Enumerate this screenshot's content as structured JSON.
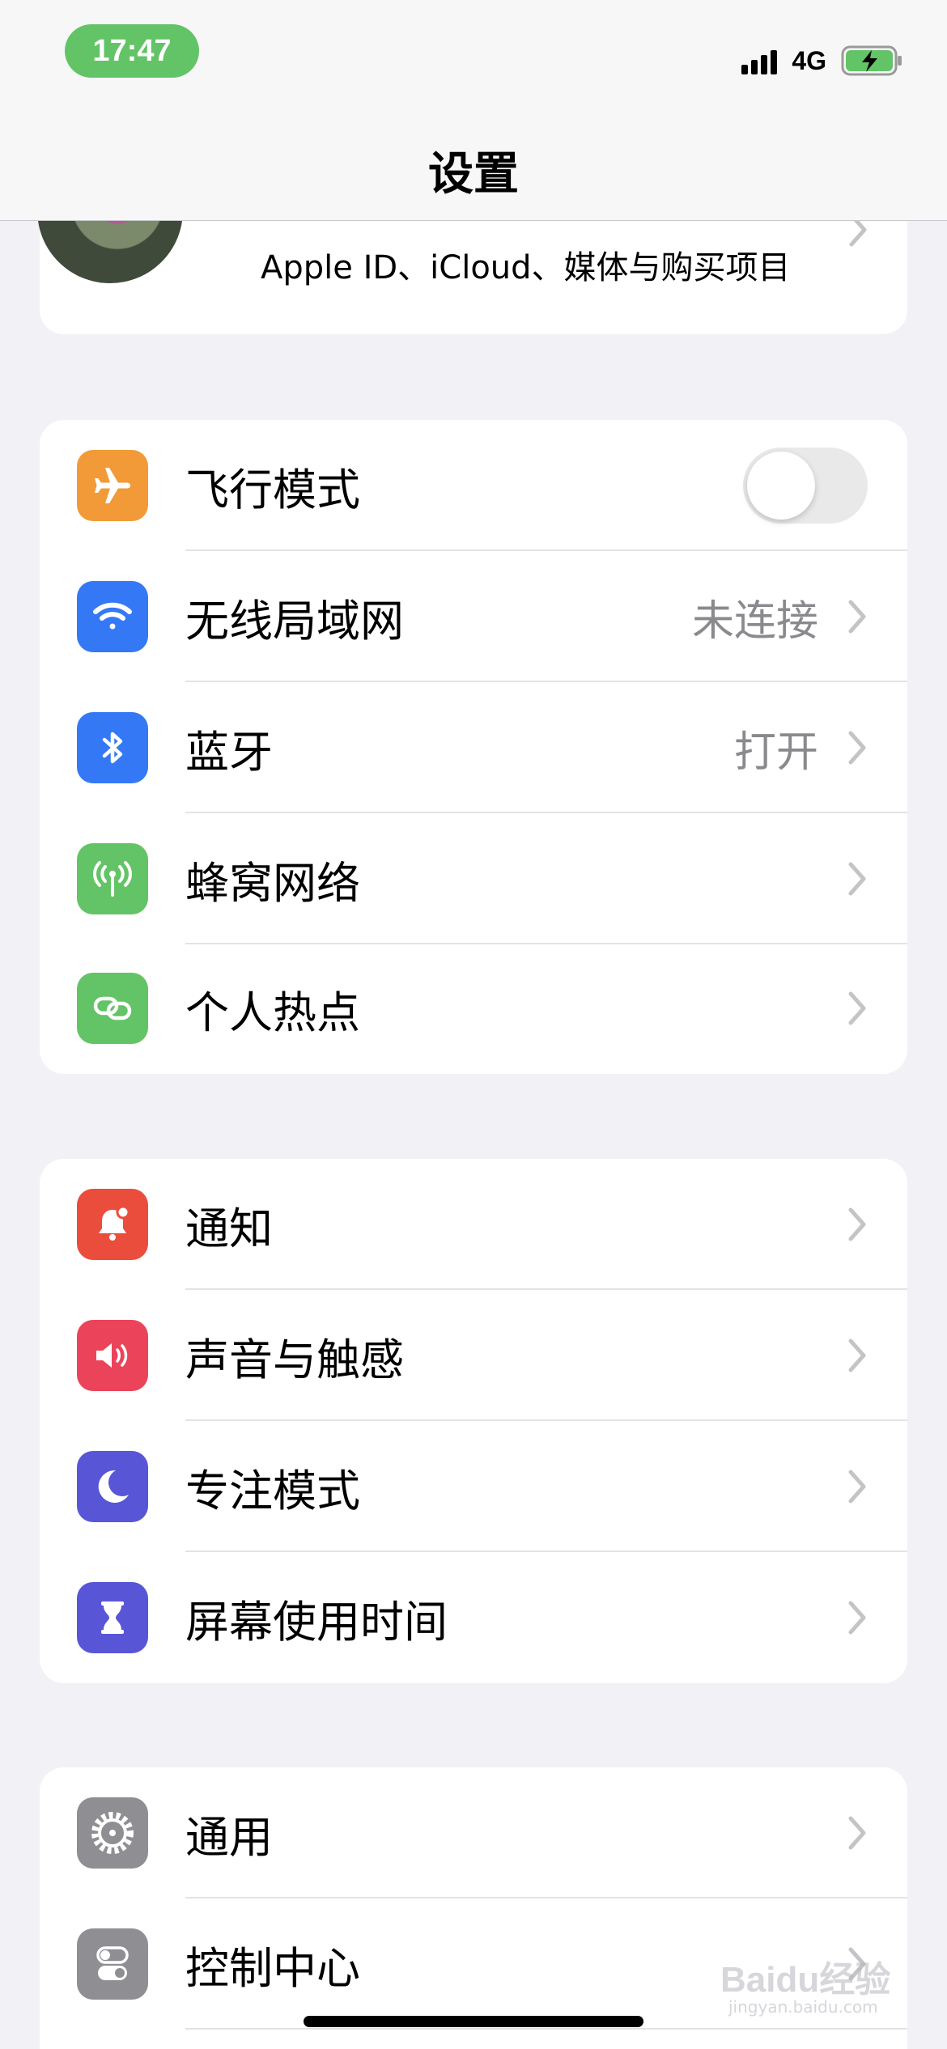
{
  "status_bar": {
    "time": "17:47",
    "network_type": "4G",
    "battery_state": "charging",
    "accent_color": "#62c466"
  },
  "nav": {
    "title": "设置"
  },
  "profile": {
    "subtitle": "Apple ID、iCloud、媒体与购买项目"
  },
  "group1": [
    {
      "label": "飞行模式",
      "icon": "airplane-icon",
      "color": "#f19a37",
      "toggle": false
    },
    {
      "label": "无线局域网",
      "icon": "wifi-icon",
      "color": "#3478f6",
      "value": "未连接"
    },
    {
      "label": "蓝牙",
      "icon": "bluetooth-icon",
      "color": "#3478f6",
      "value": "打开"
    },
    {
      "label": "蜂窝网络",
      "icon": "cellular-icon",
      "color": "#62c466"
    },
    {
      "label": "个人热点",
      "icon": "hotspot-icon",
      "color": "#62c466"
    }
  ],
  "group2": [
    {
      "label": "通知",
      "icon": "notification-bell-icon",
      "color": "#eb4d3d"
    },
    {
      "label": "声音与触感",
      "icon": "speaker-icon",
      "color": "#eb445a"
    },
    {
      "label": "专注模式",
      "icon": "moon-icon",
      "color": "#5856d6"
    },
    {
      "label": "屏幕使用时间",
      "icon": "hourglass-icon",
      "color": "#5856d6"
    }
  ],
  "group3": [
    {
      "label": "通用",
      "icon": "gear-icon",
      "color": "#8e8e93"
    },
    {
      "label": "控制中心",
      "icon": "switches-icon",
      "color": "#8e8e93"
    }
  ],
  "watermark": {
    "text": "Baidu经验",
    "sub": "jingyan.baidu.com"
  }
}
